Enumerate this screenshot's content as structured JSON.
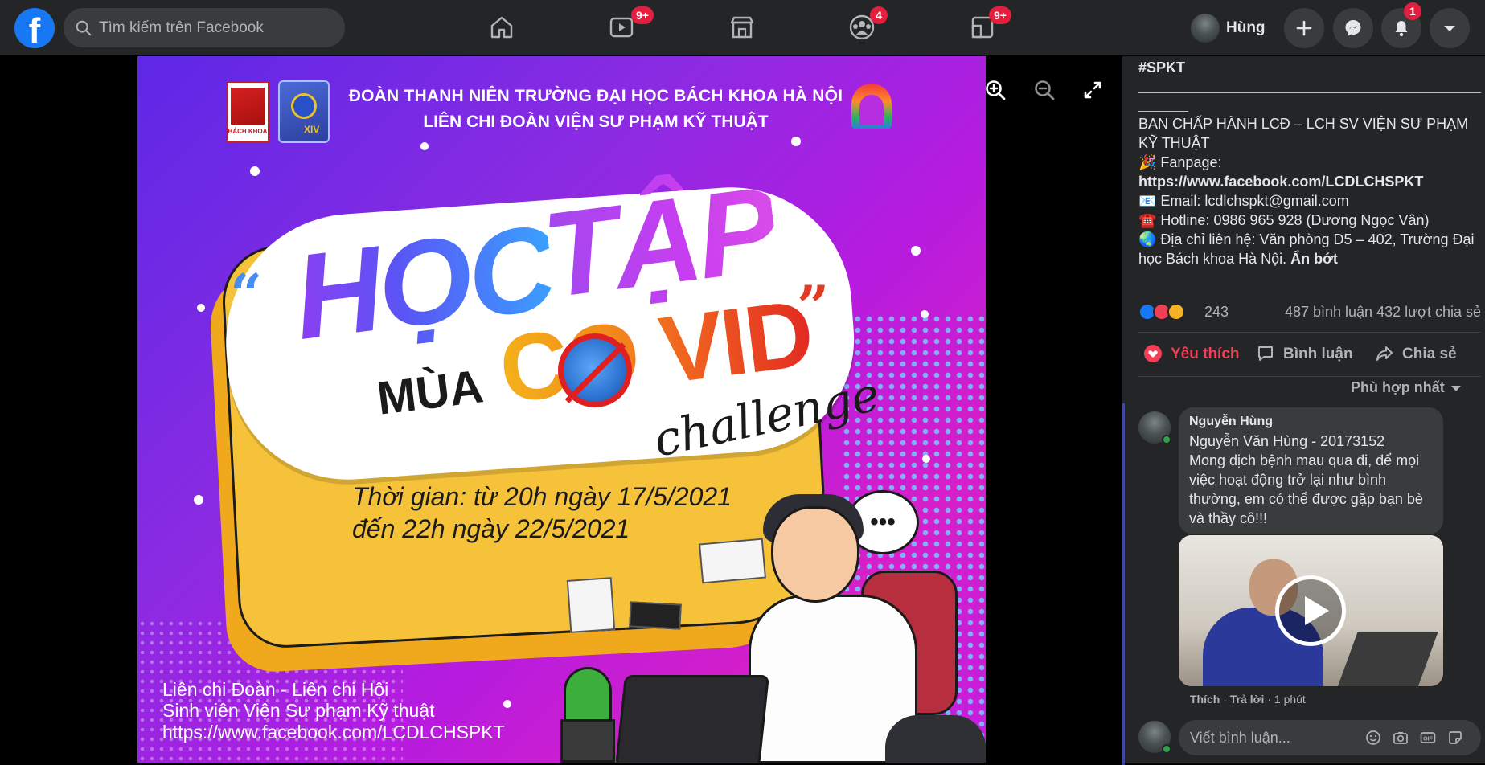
{
  "header": {
    "logo_letter": "f",
    "search_placeholder": "Tìm kiếm trên Facebook",
    "nav": [
      {
        "name": "home",
        "badge": ""
      },
      {
        "name": "watch",
        "badge": "9+"
      },
      {
        "name": "marketplace",
        "badge": ""
      },
      {
        "name": "groups",
        "badge": "4"
      },
      {
        "name": "gaming",
        "badge": "9+"
      }
    ],
    "profile_name": "Hùng",
    "notifications_badge": "1"
  },
  "poster": {
    "org_line1": "ĐOÀN THANH NIÊN TRƯỜNG ĐẠI HỌC BÁCH KHOA HÀ NỘI",
    "org_line2": "LIÊN CHI ĐOÀN VIỆN SƯ PHẠM KỸ THUẬT",
    "logo_bk_text": "BÁCH KHOA",
    "logo_tn_text": "XIV",
    "title_hoc": "HỌC",
    "title_tap": "TẬP",
    "title_mua": "MÙA",
    "title_covid": "CO  VID",
    "title_challenge": "challenge",
    "quote_open": "“",
    "quote_close": "”",
    "time_line1": "Thời gian: từ 20h ngày 17/5/2021",
    "time_line2": "đến 22h ngày 22/5/2021",
    "footer_line1": "Liên chi Đoàn - Liên chi Hội",
    "footer_line2": "Sinh viên Viện Sư phạm Kỹ thuật",
    "footer_line3": "https://www.facebook.com/LCDLCHSPKT",
    "speech_text": "•••"
  },
  "post": {
    "hashtag": "#SPKT",
    "line_bch": "BAN CHẤP HÀNH LCĐ – LCH SV VIỆN SƯ PHẠM KỸ THUẬT",
    "fanpage_label": "🎉 Fanpage:",
    "fanpage_url": "https://www.facebook.com/LCDLCHSPKT",
    "email": "📧 Email: lcdlchspkt@gmail.com",
    "hotline": "☎️ Hotline: 0986 965 928 (Dương Ngọc Vân)",
    "address": "🌏 Địa chỉ liên hệ: Văn phòng D5 – 402, Trường Đại học Bách khoa Hà Nội.",
    "see_less": "Ẩn bớt",
    "reaction_count": "243",
    "comment_share_meta": "487 bình luận  432 lượt chia sẻ",
    "actions": {
      "like": "Yêu thích",
      "comment": "Bình luận",
      "share": "Chia sẻ"
    },
    "sort_label": "Phù hợp nhất"
  },
  "comment": {
    "author": "Nguyễn Hùng",
    "line1": "Nguyễn Văn Hùng - 20173152",
    "body": "Mong dịch bệnh mau qua đi, để mọi việc hoạt động trở lại như bình thường, em có thể được gặp bạn bè và thầy cô!!!",
    "like": "Thích",
    "reply": "Trả lời",
    "time": "1 phút"
  },
  "composer": {
    "placeholder": "Viết bình luận..."
  },
  "colors": {
    "fb_blue": "#1877f2",
    "badge_red": "#e41e3f",
    "like_active": "#f33e58",
    "panel_bg": "#242526"
  }
}
